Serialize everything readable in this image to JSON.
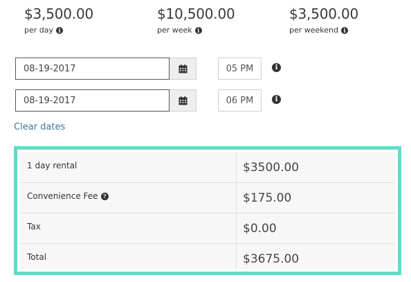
{
  "rates": [
    {
      "amount": "$3,500.00",
      "unit": "per day"
    },
    {
      "amount": "$10,500.00",
      "unit": "per week"
    },
    {
      "amount": "$3,500.00",
      "unit": "per weekend"
    }
  ],
  "booking": {
    "start_date": "08-19-2017",
    "start_time": "05 PM",
    "end_date": "08-19-2017",
    "end_time": "06 PM",
    "clear_label": "Clear dates"
  },
  "summary": {
    "rows": [
      {
        "label": "1 day rental",
        "value": "$3500.00"
      },
      {
        "label": "Convenience Fee",
        "value": "$175.00"
      },
      {
        "label": "Tax",
        "value": "$0.00"
      },
      {
        "label": "Total",
        "value": "$3675.00"
      }
    ]
  },
  "colors": {
    "summary_border": "#5fdec6",
    "link": "#3a7796"
  },
  "icons": {
    "info": "info-circle-icon",
    "calendar": "calendar-icon",
    "help": "question-circle-icon"
  }
}
